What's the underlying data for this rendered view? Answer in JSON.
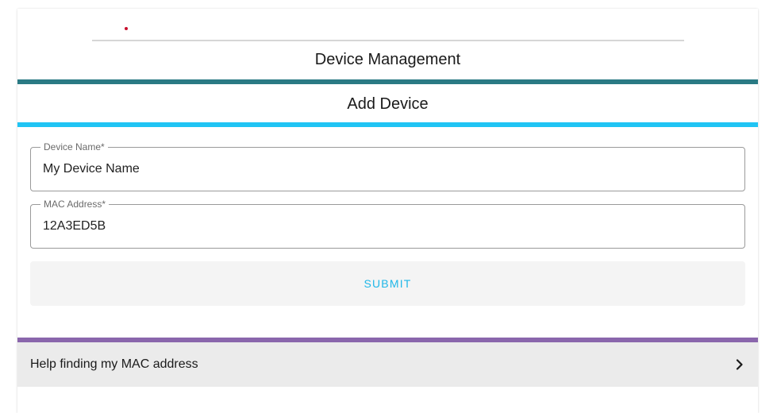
{
  "header": {
    "title": "Device Management"
  },
  "form": {
    "title": "Add Device",
    "device_name": {
      "label": "Device Name*",
      "value": "My Device Name"
    },
    "mac_address": {
      "label": "MAC Address*",
      "value": "12A3ED5B"
    },
    "submit_label": "SUBMIT"
  },
  "help": {
    "label": "Help finding my MAC address",
    "icon": "chevron-right-icon"
  },
  "colors": {
    "teal_bar": "#2a7a84",
    "sky_bar": "#20c4f4",
    "purple_bar": "#8a66ac",
    "submit_text": "#20b7e8"
  }
}
